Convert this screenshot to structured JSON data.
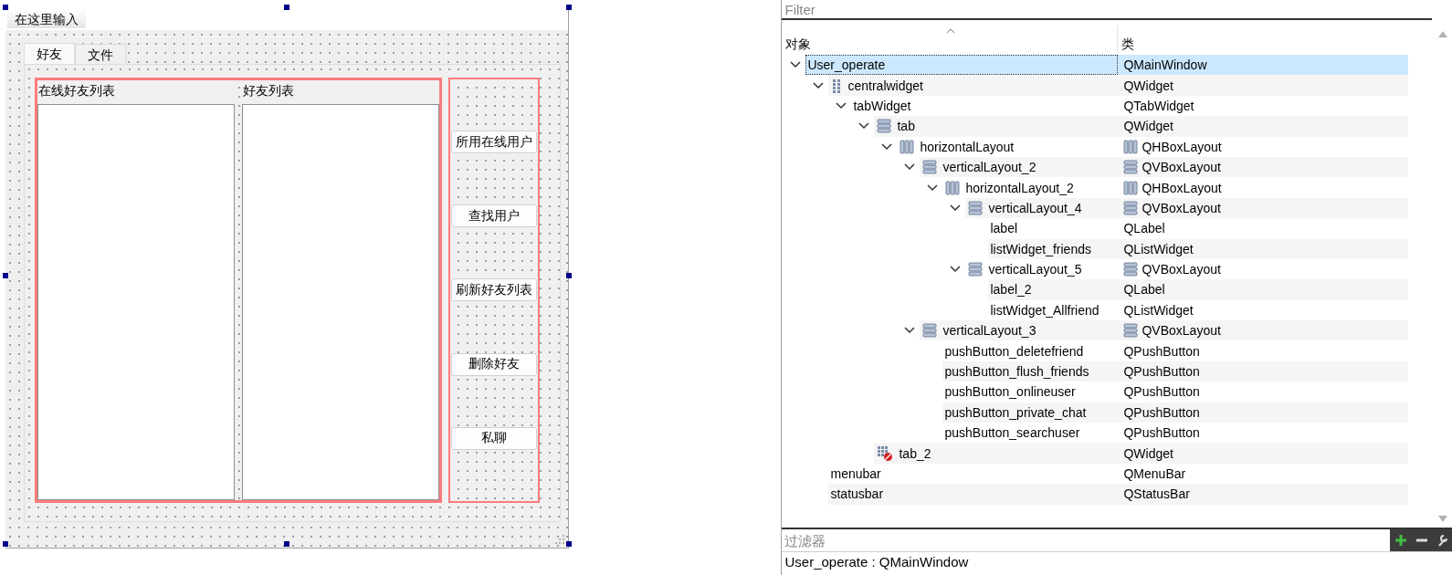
{
  "form": {
    "menu_hint": "在这里输入",
    "tabs": [
      {
        "label": "好友",
        "selected": true
      },
      {
        "label": "文件",
        "selected": false
      }
    ],
    "lists": [
      {
        "label": "在线好友列表"
      },
      {
        "label": "好友列表"
      }
    ],
    "buttons": [
      "所用在线用户",
      "查找用户",
      "刷新好友列表",
      "删除好友",
      "私聊"
    ]
  },
  "inspector": {
    "filter": {
      "placeholder": "Filter"
    },
    "columns": [
      "对象",
      "类"
    ],
    "tree": [
      {
        "name": "User_operate",
        "class": "QMainWindow",
        "selected": true,
        "expanded": true,
        "children": [
          {
            "name": "centralwidget",
            "class": "QWidget",
            "kind": "grid_widget",
            "selected": false,
            "expanded": true,
            "children": [
              {
                "name": "tabWidget",
                "class": "QTabWidget",
                "selected": false,
                "expanded": true,
                "children": [
                  {
                    "name": "tab",
                    "class": "QWidget",
                    "kind": "stacked_widget",
                    "selected": false,
                    "expanded": true,
                    "children": [
                      {
                        "name": "horizontalLayout",
                        "class": "QHBoxLayout",
                        "kind": "hbox_layout",
                        "selected": false,
                        "expanded": true,
                        "children": [
                          {
                            "name": "verticalLayout_2",
                            "class": "QVBoxLayout",
                            "kind": "vbox_layout",
                            "selected": false,
                            "expanded": true,
                            "children": [
                              {
                                "name": "horizontalLayout_2",
                                "class": "QHBoxLayout",
                                "kind": "hbox_layout",
                                "selected": false,
                                "expanded": true,
                                "children": [
                                  {
                                    "name": "verticalLayout_4",
                                    "class": "QVBoxLayout",
                                    "kind": "vbox_layout",
                                    "selected": false,
                                    "expanded": true,
                                    "children": [
                                      {
                                        "name": "label",
                                        "class": "QLabel",
                                        "selected": false
                                      },
                                      {
                                        "name": "listWidget_friends",
                                        "class": "QListWidget",
                                        "selected": false
                                      }
                                    ]
                                  },
                                  {
                                    "name": "verticalLayout_5",
                                    "class": "QVBoxLayout",
                                    "kind": "vbox_layout",
                                    "selected": false,
                                    "expanded": true,
                                    "children": [
                                      {
                                        "name": "label_2",
                                        "class": "QLabel",
                                        "selected": false
                                      },
                                      {
                                        "name": "listWidget_Allfriend",
                                        "class": "QListWidget",
                                        "selected": false
                                      }
                                    ]
                                  }
                                ]
                              }
                            ]
                          },
                          {
                            "name": "verticalLayout_3",
                            "class": "QVBoxLayout",
                            "kind": "vbox_layout",
                            "selected": false,
                            "expanded": true,
                            "children": [
                              {
                                "name": "pushButton_deletefriend",
                                "class": "QPushButton",
                                "selected": false
                              },
                              {
                                "name": "pushButton_flush_friends",
                                "class": "QPushButton",
                                "selected": false
                              },
                              {
                                "name": "pushButton_onlineuser",
                                "class": "QPushButton",
                                "selected": false
                              },
                              {
                                "name": "pushButton_private_chat",
                                "class": "QPushButton",
                                "selected": false
                              },
                              {
                                "name": "pushButton_searchuser",
                                "class": "QPushButton",
                                "selected": false
                              }
                            ]
                          }
                        ]
                      }
                    ]
                  },
                  {
                    "name": "tab_2",
                    "class": "QWidget",
                    "kind": "broken_widget",
                    "selected": false
                  }
                ]
              }
            ]
          },
          {
            "name": "menubar",
            "class": "QMenuBar",
            "selected": false
          },
          {
            "name": "statusbar",
            "class": "QStatusBar",
            "selected": false
          }
        ]
      }
    ],
    "property_filter": {
      "placeholder": "过滤器"
    },
    "status": "User_operate : QMainWindow"
  }
}
